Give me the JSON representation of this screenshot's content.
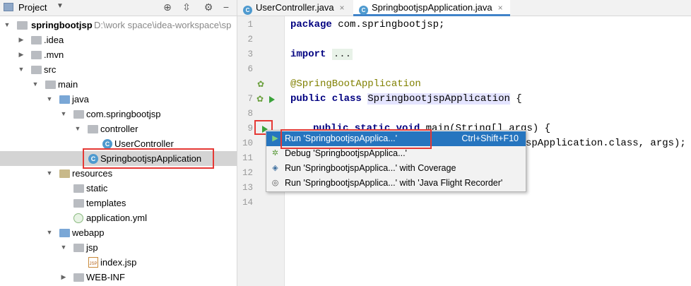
{
  "project_panel": {
    "title": "Project",
    "tools": [
      "crosshair-icon",
      "collapse-icon",
      "gear-icon",
      "minimize-icon"
    ],
    "tree": [
      {
        "label": "springbootjsp",
        "path": "D:\\work space\\idea-workspace\\sp",
        "bold": true
      },
      {
        "label": ".idea"
      },
      {
        "label": ".mvn"
      },
      {
        "label": "src"
      },
      {
        "label": "main"
      },
      {
        "label": "java"
      },
      {
        "label": "com.springbootjsp"
      },
      {
        "label": "controller"
      },
      {
        "label": "UserController"
      },
      {
        "label": "SpringbootjspApplication",
        "selected": true
      },
      {
        "label": "resources"
      },
      {
        "label": "static"
      },
      {
        "label": "templates"
      },
      {
        "label": "application.yml"
      },
      {
        "label": "webapp"
      },
      {
        "label": "jsp"
      },
      {
        "label": "index.jsp"
      },
      {
        "label": "WEB-INF"
      }
    ]
  },
  "editor": {
    "tabs": [
      {
        "label": "UserController.java",
        "active": false
      },
      {
        "label": "SpringbootjspApplication.java",
        "active": true
      }
    ],
    "line_numbers": [
      "1",
      "2",
      "3",
      "6",
      "7",
      "8",
      "9",
      "10",
      "11",
      "12",
      "13",
      "14"
    ],
    "code": {
      "l1_kw": "package",
      "l1_rest": " com.springbootjsp;",
      "l3_kw": "import",
      "l3_fold": "...",
      "l6": "@SpringBootApplication",
      "l7_kw": "public class",
      "l7_cls": "SpringbootjspApplication",
      "l7_rest": " {",
      "l9_kw": "public static void",
      "l9_rest": " main(String[] args) {",
      "l10": "spApplication.class, args);",
      "l13": "}"
    }
  },
  "context_menu": {
    "items": [
      {
        "label": "Run 'SpringbootjspApplica...'",
        "shortcut": "Ctrl+Shift+F10",
        "selected": true
      },
      {
        "label": "Debug 'SpringbootjspApplica...'"
      },
      {
        "label": "Run 'SpringbootjspApplica...' with Coverage"
      },
      {
        "label": "Run 'SpringbootjspApplica...' with 'Java Flight Recorder'"
      }
    ]
  },
  "colors": {
    "highlight_box": "#e53935",
    "menu_selection": "#2675bf",
    "run_green": "#3aa33a",
    "keyword": "#000080",
    "annotation": "#808000"
  }
}
